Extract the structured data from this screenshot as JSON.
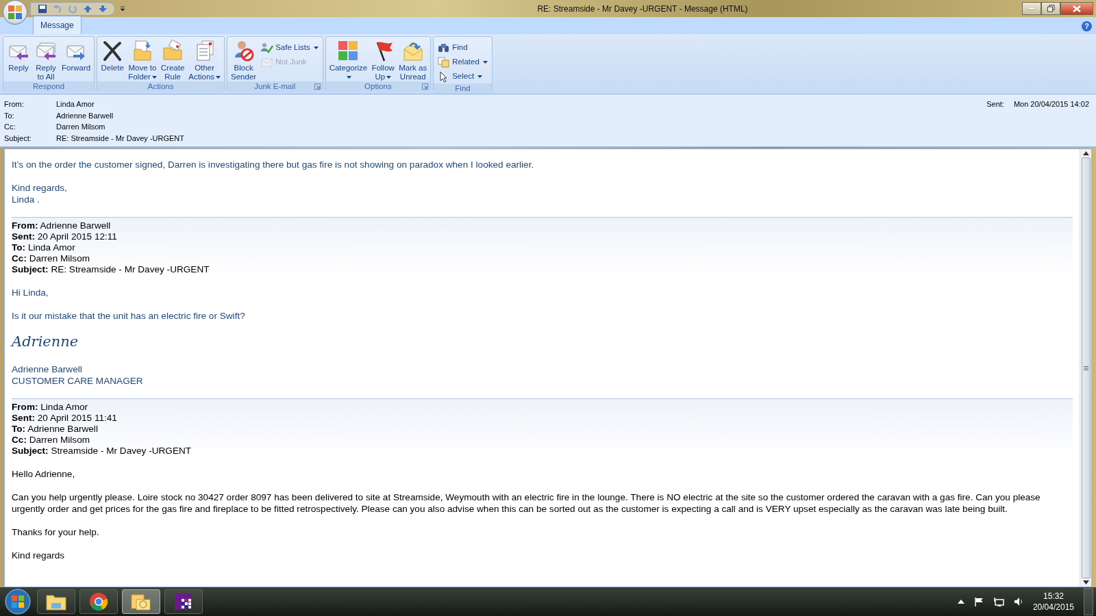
{
  "window": {
    "title": "RE: Streamside - Mr Davey -URGENT - Message (HTML)"
  },
  "tabs": [
    {
      "label": "Message",
      "selected": true
    }
  ],
  "help": {
    "label": "?"
  },
  "ribbon": [
    {
      "name": "Respond",
      "launcher": false,
      "buttons": [
        {
          "kind": "large",
          "lines": [
            "Reply"
          ],
          "dropdown": false
        },
        {
          "kind": "large",
          "lines": [
            "Reply",
            "to All"
          ],
          "dropdown": false
        },
        {
          "kind": "large",
          "lines": [
            "Forward"
          ],
          "dropdown": false
        }
      ]
    },
    {
      "name": "Actions",
      "launcher": false,
      "buttons": [
        {
          "kind": "large",
          "lines": [
            "Delete"
          ],
          "dropdown": false
        },
        {
          "kind": "large",
          "lines": [
            "Move to",
            "Folder"
          ],
          "dropdown": true
        },
        {
          "kind": "large",
          "lines": [
            "Create",
            "Rule"
          ],
          "dropdown": false
        },
        {
          "kind": "large",
          "lines": [
            "Other",
            "Actions"
          ],
          "dropdown": true
        }
      ]
    },
    {
      "name": "Junk E-mail",
      "launcher": true,
      "buttons": [
        {
          "kind": "large",
          "lines": [
            "Block",
            "Sender"
          ],
          "dropdown": false
        },
        {
          "kind": "stack",
          "items": [
            {
              "label": "Safe Lists",
              "dropdown": true,
              "disabled": false
            },
            {
              "label": "Not Junk",
              "dropdown": false,
              "disabled": true
            }
          ]
        }
      ]
    },
    {
      "name": "Options",
      "launcher": true,
      "buttons": [
        {
          "kind": "large",
          "lines": [
            "Categorize"
          ],
          "dropdown": true
        },
        {
          "kind": "large",
          "lines": [
            "Follow",
            "Up"
          ],
          "dropdown": true
        },
        {
          "kind": "large",
          "lines": [
            "Mark as",
            "Unread"
          ],
          "dropdown": false
        }
      ]
    },
    {
      "name": "Find",
      "launcher": false,
      "buttons": [
        {
          "kind": "stack",
          "items": [
            {
              "label": "Find",
              "dropdown": false,
              "disabled": false
            },
            {
              "label": "Related",
              "dropdown": true,
              "disabled": false
            },
            {
              "label": "Select",
              "dropdown": true,
              "disabled": false
            }
          ]
        }
      ]
    }
  ],
  "header": {
    "fields": [
      {
        "label": "From:",
        "value": "Linda Amor"
      },
      {
        "label": "To:",
        "value": "Adrienne Barwell"
      },
      {
        "label": "Cc:",
        "value": "Darren Milsom"
      },
      {
        "label": "Subject:",
        "value": "RE: Streamside - Mr Davey -URGENT"
      }
    ],
    "sent": {
      "label": "Sent:",
      "value": "Mon 20/04/2015 14:02"
    }
  },
  "body": [
    {
      "kind": "paragraph",
      "quoted": false,
      "lines": [
        "It’s on the order the customer signed, Darren is investigating there but gas fire is not showing on paradox when I looked earlier."
      ]
    },
    {
      "kind": "paragraph",
      "quoted": false,
      "lines": [
        "Kind regards,",
        "Linda ."
      ]
    },
    {
      "kind": "quote_header",
      "lines": [
        "**From:** Adrienne Barwell",
        "**Sent:** 20 April 2015 12:11",
        "**To:** Linda Amor",
        "**Cc:** Darren Milsom",
        "**Subject:** RE: Streamside - Mr Davey -URGENT"
      ]
    },
    {
      "kind": "paragraph",
      "quoted": false,
      "lines": [
        "Hi Linda,"
      ]
    },
    {
      "kind": "paragraph",
      "quoted": false,
      "lines": [
        "Is it our mistake that the unit has an electric fire or Swift?"
      ]
    },
    {
      "kind": "signature",
      "text": "Adrienne"
    },
    {
      "kind": "paragraph",
      "quoted": false,
      "lines": [
        "Adrienne Barwell",
        "CUSTOMER CARE MANAGER"
      ]
    },
    {
      "kind": "quote_header",
      "lines": [
        "**From:** Linda Amor",
        "**Sent:** 20 April 2015 11:41",
        "**To:** Adrienne Barwell",
        "**Cc:** Darren Milsom",
        "**Subject:** Streamside - Mr Davey -URGENT"
      ]
    },
    {
      "kind": "paragraph",
      "quoted": true,
      "lines": [
        "Hello Adrienne,"
      ]
    },
    {
      "kind": "paragraph",
      "quoted": true,
      "lines": [
        "Can you help urgently please.  Loire stock no 30427 order 8097 has been delivered to site at Streamside, Weymouth with an electric fire in the lounge.  There is NO electric at the site so the customer ordered the caravan with a gas fire.  Can you please urgently order and get prices for the gas fire and fireplace to be fitted retrospectively.  Please can you also advise when this can be sorted out as the customer is expecting a call and is VERY upset especially as the caravan was late being built."
      ]
    },
    {
      "kind": "paragraph",
      "quoted": true,
      "lines": [
        "Thanks for your help."
      ]
    },
    {
      "kind": "paragraph",
      "quoted": true,
      "lines": [
        "Kind regards"
      ]
    }
  ],
  "taskbar": {
    "apps": [
      {
        "kind": "explorer",
        "active": false
      },
      {
        "kind": "chrome",
        "active": false
      },
      {
        "kind": "outlook",
        "active": true
      },
      {
        "kind": "grid",
        "active": false
      }
    ],
    "time": "15:32",
    "date": "20/04/2015"
  }
}
